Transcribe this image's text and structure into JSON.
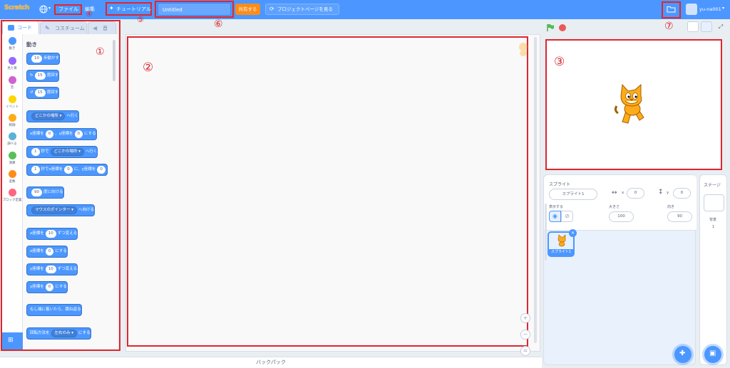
{
  "menubar": {
    "logo": "Scratch",
    "file_menu": "ファイル",
    "edit_menu": "編集",
    "tutorials": "チュートリアル",
    "project_title": "Untitled",
    "share_button": "共有する",
    "project_page_button": "プロジェクトページを見る",
    "username": "yu-na001"
  },
  "tabs": {
    "code": "コード",
    "costumes": "コスチューム",
    "sounds": "音"
  },
  "categories": [
    {
      "label": "動き",
      "color": "#4c97ff"
    },
    {
      "label": "見た目",
      "color": "#9966ff"
    },
    {
      "label": "音",
      "color": "#cf63cf"
    },
    {
      "label": "イベント",
      "color": "#ffd500"
    },
    {
      "label": "制御",
      "color": "#ffab19"
    },
    {
      "label": "調べる",
      "color": "#5cb1d6"
    },
    {
      "label": "演算",
      "color": "#59c059"
    },
    {
      "label": "変数",
      "color": "#ff8c1a"
    },
    {
      "label": "ブロック定義",
      "color": "#ff6680"
    }
  ],
  "palette": {
    "heading": "動き",
    "blocks": {
      "move": {
        "n": "10",
        "t": "歩動かす"
      },
      "turn_right": {
        "n": "15",
        "t": "度回す"
      },
      "turn_left": {
        "n": "15",
        "t": "度回す"
      },
      "goto": {
        "dd": "どこかの場所",
        "t": "へ行く"
      },
      "goto_xy": {
        "a": "x座標を",
        "x": "0",
        "b": "、y座標を",
        "y": "0",
        "c": "にする"
      },
      "glide_to": {
        "n": "1",
        "a": "秒で",
        "dd": "どこかの場所",
        "c": "へ行く"
      },
      "glide_xy": {
        "n": "1",
        "a": "秒でx座標を",
        "x": "0",
        "b": "に、y座標を",
        "y": "0"
      },
      "point_dir": {
        "n": "90",
        "t": "度に向ける"
      },
      "point_towards": {
        "dd": "マウスのポインター",
        "t": "へ向ける"
      },
      "change_x": {
        "a": "x座標を",
        "n": "10",
        "t": "ずつ変える"
      },
      "set_x": {
        "a": "x座標を",
        "n": "0",
        "t": "にする"
      },
      "change_y": {
        "a": "y座標を",
        "n": "10",
        "t": "ずつ変える"
      },
      "set_y": {
        "a": "y座標を",
        "n": "0",
        "t": "にする"
      },
      "bounce": {
        "t": "もし端に着いたら、跳ね返る"
      },
      "rotation": {
        "a": "回転方法を",
        "dd": "左右のみ",
        "t": "にする"
      }
    }
  },
  "annotations": [
    "①",
    "②",
    "③",
    "④",
    "⑤",
    "⑥",
    "⑦"
  ],
  "sprite_info": {
    "sprite_label": "スプライト",
    "sprite_name": "スプライト1",
    "x_label": "x",
    "x_value": "0",
    "y_label": "y",
    "y_value": "0",
    "show_label": "表示する",
    "size_label": "大きさ",
    "size_value": "100",
    "direction_label": "向き",
    "direction_value": "90",
    "sprite_thumb_label": "スプライト1"
  },
  "stage_panel": {
    "title": "ステージ",
    "backdrops_label": "背景",
    "backdrops_count": "1"
  },
  "backpack": "バックパック",
  "colors": {
    "menubar": "#4c97ff",
    "annotation_red": "#e0262e",
    "motion_block": "#4c97ff"
  }
}
